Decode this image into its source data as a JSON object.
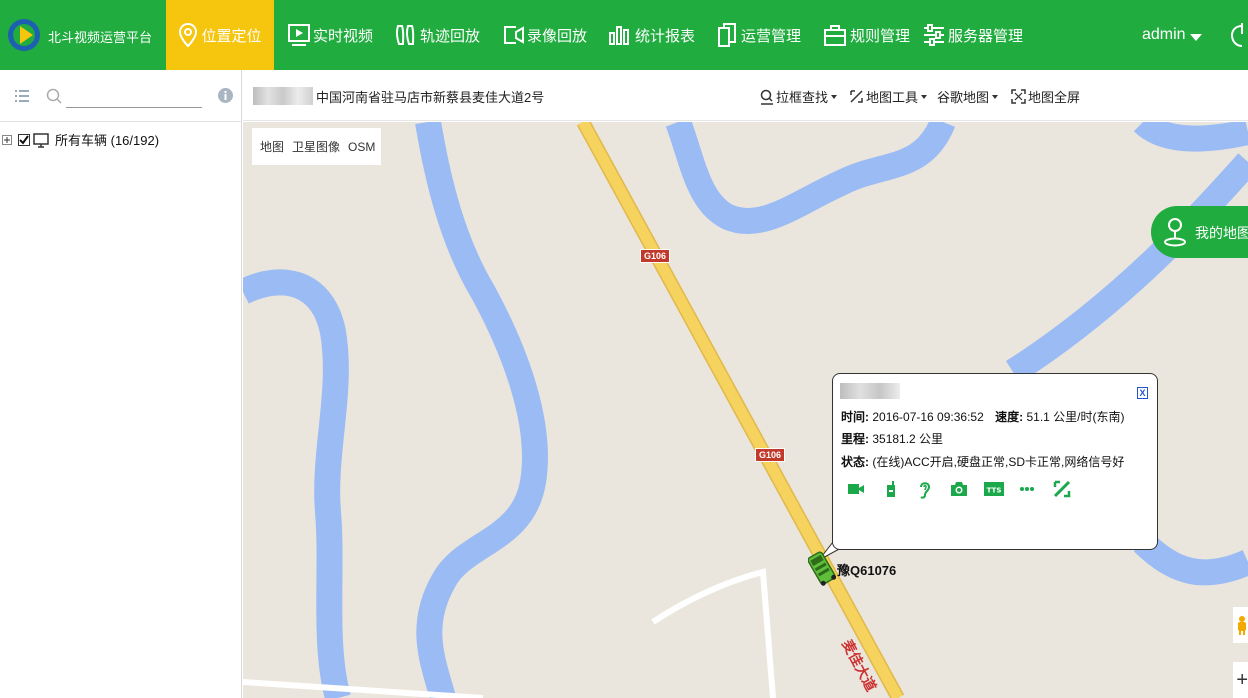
{
  "app": {
    "brand": "北斗视频运营平台"
  },
  "nav": [
    {
      "label": "位置定位",
      "icon": "location-pin-icon",
      "active": true
    },
    {
      "label": "实时视频",
      "icon": "play-screen-icon"
    },
    {
      "label": "轨迹回放",
      "icon": "footprint-icon"
    },
    {
      "label": "录像回放",
      "icon": "video-replay-icon"
    },
    {
      "label": "统计报表",
      "icon": "bar-chart-icon"
    },
    {
      "label": "运营管理",
      "icon": "document-icon"
    },
    {
      "label": "规则管理",
      "icon": "briefcase-icon"
    },
    {
      "label": "服务器管理",
      "icon": "sliders-icon"
    }
  ],
  "user": {
    "name": "admin"
  },
  "sidebar": {
    "search_placeholder": "",
    "tree_root": "所有车辆 (16/192)",
    "tree_root_checked": true
  },
  "toolbar": {
    "address": "中国河南省驻马店市新蔡县麦佳大道2号",
    "box_search": "拉框查找",
    "map_tools": "地图工具",
    "google_map": "谷歌地图",
    "fullscreen": "地图全屏"
  },
  "map": {
    "types": [
      "地图",
      "卫星图像",
      "OSM"
    ],
    "my_map": "我的地图",
    "road_badge_1": "G106",
    "road_badge_2": "G106",
    "road_name": "麦佳大道",
    "vehicle_plate": "豫Q61076"
  },
  "popup": {
    "time_label": "时间:",
    "time_value": "2016-07-16 09:36:52",
    "speed_label": "速度:",
    "speed_value": "51.1 公里/时(东南)",
    "mileage_label": "里程:",
    "mileage_value": "35181.2 公里",
    "status_label": "状态:",
    "status_value": "(在线)ACC开启,硬盘正常,SD卡正常,网络信号好",
    "close": "X",
    "tts": "TTS",
    "actions": [
      "video-camera-icon",
      "walkie-talkie-icon",
      "listen-ear-icon",
      "camera-icon",
      "tts-icon",
      "more-icon",
      "tools-icon"
    ]
  },
  "colors": {
    "brand_green": "#21ac3f",
    "active_yellow": "#f6c50d",
    "river_blue": "#9bbbf4",
    "road_yellow": "#f6d25f"
  }
}
